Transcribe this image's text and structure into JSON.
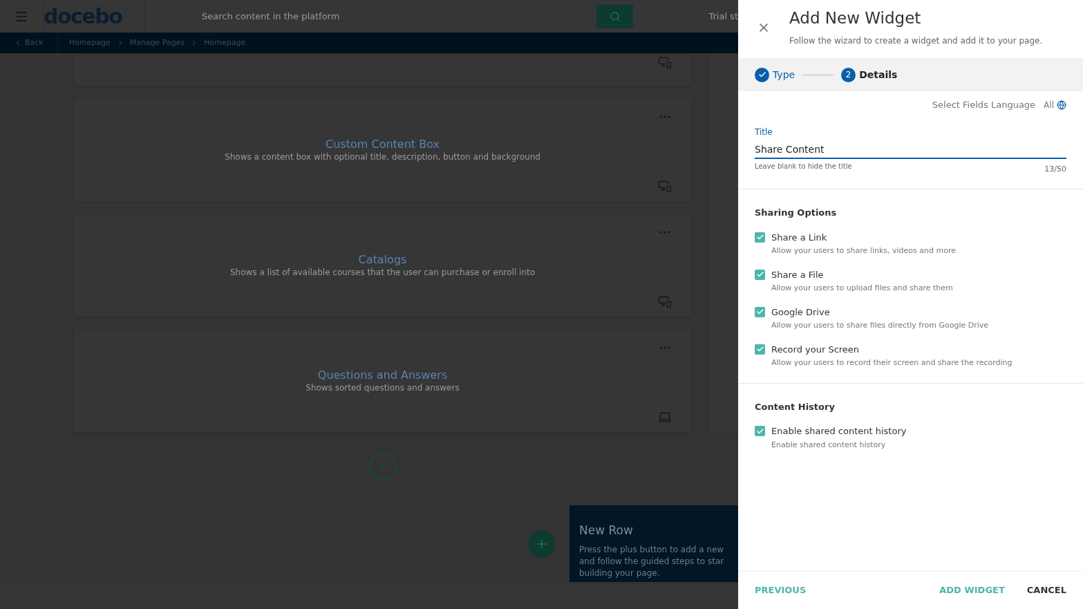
{
  "header": {
    "logo": "docebo",
    "search": {
      "placeholder": "Search content in the platform"
    },
    "trial_text": "Trial st"
  },
  "breadcrumb": {
    "back": "Back",
    "items": [
      "Homepage",
      "Manage Pages",
      "Homepage"
    ]
  },
  "widgets": [
    {
      "kind": "partial"
    },
    {
      "title": "Custom Content Box",
      "description": "Shows a content box with optional title, description, button and background",
      "kind": "full"
    },
    {
      "title": "Catalogs",
      "description": "Shows a list of available courses that the user can purchase or enroll into",
      "kind": "full"
    },
    {
      "title": "Questions and Answers",
      "description": "Shows sorted questions and answers",
      "kind": "desktop"
    }
  ],
  "tooltip": {
    "title": "New Row",
    "text": "Press the plus button to add a new\nand follow the guided steps to star\nbuilding your page."
  },
  "panel": {
    "title": "Add New Widget",
    "subtitle": "Follow the wizard to create a widget and add it to your page.",
    "steps": [
      {
        "label": "Type",
        "done": true,
        "selected": false
      },
      {
        "label": "Details",
        "number": "2",
        "done": false,
        "selected": true
      }
    ],
    "language": {
      "label": "Select Fields Language",
      "value": "All"
    },
    "title_field": {
      "label": "Title",
      "value": "Share Content",
      "hint": "Leave blank to hide the title",
      "counter": "13/50"
    },
    "sections": [
      {
        "heading": "Sharing Options",
        "options": [
          {
            "label": "Share a Link",
            "description": "Allow your users to share links, videos and more",
            "checked": true
          },
          {
            "label": "Share a File",
            "description": "Allow your users to upload files and share them",
            "checked": true
          },
          {
            "label": "Google Drive",
            "description": "Allow your users to share files directly from Google Drive",
            "checked": true
          },
          {
            "label": "Record your Screen",
            "description": "Allow your users to record their screen and share the recording",
            "checked": true
          }
        ]
      },
      {
        "heading": "Content History",
        "options": [
          {
            "label": "Enable shared content history",
            "description": "Enable shared content history",
            "checked": true
          }
        ]
      }
    ],
    "footer": {
      "previous": "PREVIOUS",
      "add": "ADD WIDGET",
      "cancel": "CANCEL"
    }
  }
}
